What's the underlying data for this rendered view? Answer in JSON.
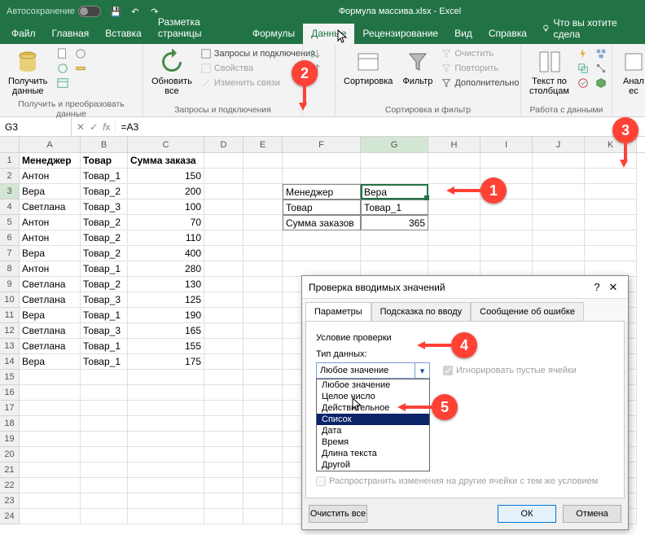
{
  "titlebar": {
    "autosave": "Автосохранение",
    "title": "Формула массива.xlsx - Excel"
  },
  "menu": {
    "file": "Файл",
    "home": "Главная",
    "insert": "Вставка",
    "layout": "Разметка страницы",
    "formulas": "Формулы",
    "data": "Данные",
    "review": "Рецензирование",
    "view": "Вид",
    "help": "Справка",
    "tellme": "Что вы хотите сдела"
  },
  "ribbon": {
    "getdata": "Получить\nданные",
    "grp1": "Получить и преобразовать данные",
    "refresh": "Обновить\nвсе",
    "queries": "Запросы и подключения",
    "props": "Свойства",
    "editlinks": "Изменить связи",
    "grp2": "Запросы и подключения",
    "sort": "Сортировка",
    "filter": "Фильтр",
    "clear": "Очистить",
    "reapply": "Повторить",
    "advanced": "Дополнительно",
    "grp3": "Сортировка и фильтр",
    "texttocol": "Текст по\nстолбцам",
    "grp4": "Работа с данными",
    "analyze": "Анал\nес"
  },
  "fbar": {
    "name": "G3",
    "fx": "=A3"
  },
  "cols": [
    "A",
    "B",
    "C",
    "D",
    "E",
    "F",
    "G",
    "H",
    "I",
    "J",
    "K"
  ],
  "headers": {
    "a": "Менеджер",
    "b": "Товар",
    "c": "Сумма заказа"
  },
  "tableA": [
    {
      "a": "Антон",
      "b": "Товар_1",
      "c": "150"
    },
    {
      "a": "Вера",
      "b": "Товар_2",
      "c": "200"
    },
    {
      "a": "Светлана",
      "b": "Товар_3",
      "c": "100"
    },
    {
      "a": "Антон",
      "b": "Товар_2",
      "c": "70"
    },
    {
      "a": "Антон",
      "b": "Товар_2",
      "c": "110"
    },
    {
      "a": "Вера",
      "b": "Товар_2",
      "c": "400"
    },
    {
      "a": "Антон",
      "b": "Товар_1",
      "c": "280"
    },
    {
      "a": "Светлана",
      "b": "Товар_2",
      "c": "130"
    },
    {
      "a": "Светлана",
      "b": "Товар_3",
      "c": "125"
    },
    {
      "a": "Вера",
      "b": "Товар_1",
      "c": "190"
    },
    {
      "a": "Светлана",
      "b": "Товар_3",
      "c": "165"
    },
    {
      "a": "Светлана",
      "b": "Товар_1",
      "c": "155"
    },
    {
      "a": "Вера",
      "b": "Товар_1",
      "c": "175"
    }
  ],
  "tableF": {
    "r3f": "Менеджер",
    "r3g": "Вера",
    "r4f": "Товар",
    "r4g": "Товар_1",
    "r5f": "Сумма заказов",
    "r5g": "365"
  },
  "dialog": {
    "title": "Проверка вводимых значений",
    "tab1": "Параметры",
    "tab2": "Подсказка по вводу",
    "tab3": "Сообщение об ошибке",
    "cond": "Условие проверки",
    "type": "Тип данных:",
    "selected": "Любое значение",
    "ignore": "Игнорировать пустые ячейки",
    "spread": "Распространить изменения на другие ячейки с тем же условием",
    "clear": "Очистить все",
    "ok": "ОК",
    "cancel": "Отмена",
    "opts": [
      "Любое значение",
      "Целое число",
      "Действительное",
      "Список",
      "Дата",
      "Время",
      "Длина текста",
      "Другой"
    ]
  },
  "callouts": {
    "1": "1",
    "2": "2",
    "3": "3",
    "4": "4",
    "5": "5"
  }
}
